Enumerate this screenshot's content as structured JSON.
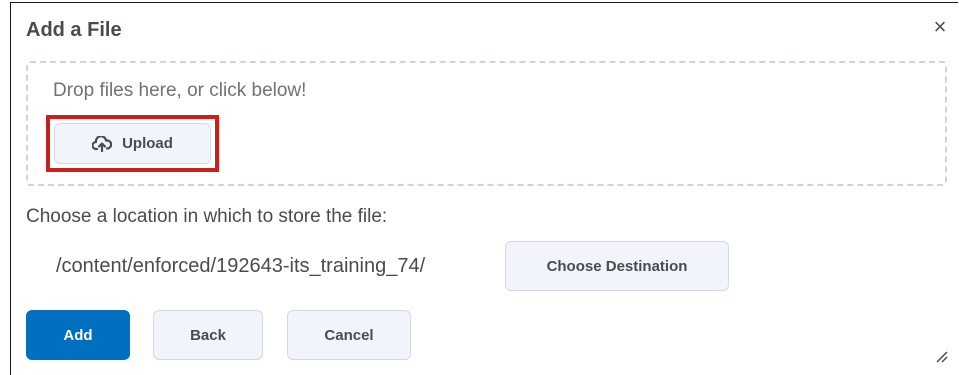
{
  "dialog": {
    "title": "Add a File",
    "close_icon": "close-icon",
    "close_glyph": "×"
  },
  "dropzone": {
    "prompt": "Drop files here, or click below!",
    "upload_label": "Upload",
    "upload_icon": "cloud-upload-icon"
  },
  "location": {
    "label": "Choose a location in which to store the file:",
    "path": "/content/enforced/192643-its_training_74/",
    "choose_label": "Choose Destination"
  },
  "actions": {
    "add_label": "Add",
    "back_label": "Back",
    "cancel_label": "Cancel"
  },
  "colors": {
    "primary": "#006fbf",
    "highlight": "#c8201b",
    "text": "#494c4e",
    "button_bg": "#f1f5fb"
  }
}
